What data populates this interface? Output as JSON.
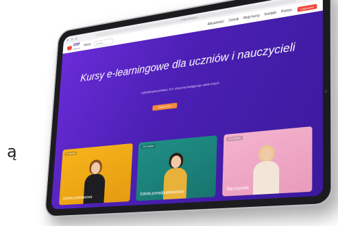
{
  "stray_letter": "ą",
  "browser": {
    "url": "ehiperlekcja.pl"
  },
  "nav": {
    "logo_text": "OSP",
    "logo_sub": "akademia",
    "items": [
      "Kursy",
      "Aktualności",
      "Cennik",
      "Moje kursy",
      "Kontakt",
      "Pomoc"
    ],
    "search_placeholder": "Szukaj...",
    "login_label": "Logowanie"
  },
  "hero": {
    "title": "Kursy e-learningowe dla uczniów i nauczycieli",
    "subtitle": "Cyberbezpieczeństwo, ICT, sztuczna inteligencja i wiele innych",
    "button_label": "Wybierz kurs"
  },
  "cards": [
    {
      "tag": "8+ kursów",
      "label": "Szkoła podstawowa"
    },
    {
      "tag": "10+ kursów",
      "label": "Szkoła ponadpodstawowa"
    },
    {
      "tag": "12+ kursów",
      "label": "Nauczyciele"
    }
  ],
  "colors": {
    "hero_purple": "#5a23c8",
    "accent_red": "#f0483e",
    "card_yellow": "#f6b51b",
    "card_teal": "#1f8f86",
    "card_pink": "#f4b3ce"
  }
}
